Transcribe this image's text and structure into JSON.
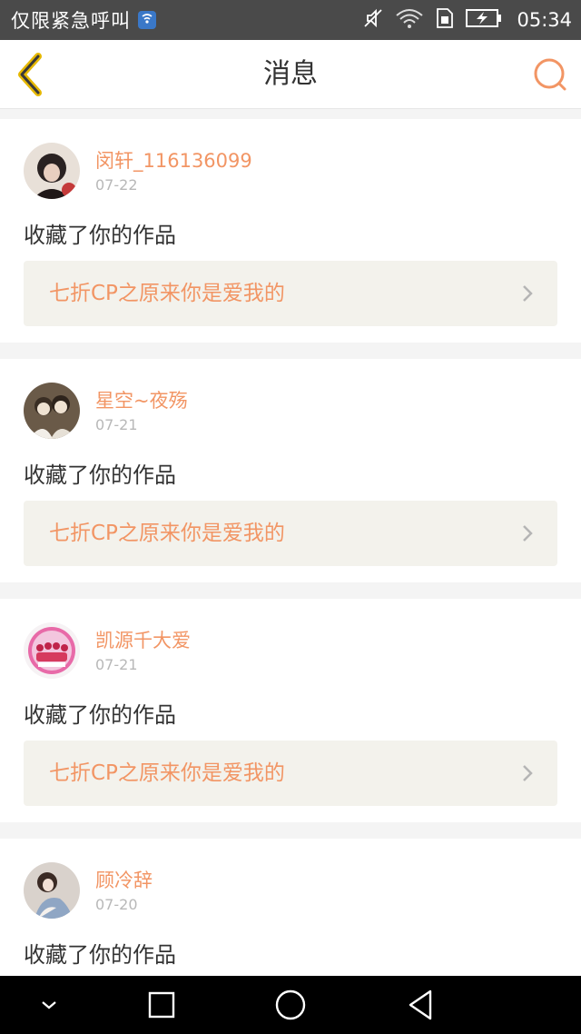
{
  "status_bar": {
    "carrier": "仅限紧急呼叫",
    "time": "05:34"
  },
  "header": {
    "title": "消息"
  },
  "colors": {
    "accent": "#f29564",
    "back_icon": "#e6b800",
    "work_bg": "#f3f2ec"
  },
  "messages": [
    {
      "username": "闵轩_116136099",
      "date": "07-22",
      "action": "收藏了你的作品",
      "work_title": "七折CP之原来你是爱我的",
      "avatar_icon": "avatar-dark-hair-icon"
    },
    {
      "username": "星空~夜殇",
      "date": "07-21",
      "action": "收藏了你的作品",
      "work_title": "七折CP之原来你是爱我的",
      "avatar_icon": "avatar-couple-photo-icon"
    },
    {
      "username": "凯源千大爱",
      "date": "07-21",
      "action": "收藏了你的作品",
      "work_title": "七折CP之原来你是爱我的",
      "avatar_icon": "avatar-group-pink-icon"
    },
    {
      "username": "顾冷辞",
      "date": "07-20",
      "action": "收藏了你的作品",
      "work_title": "",
      "avatar_icon": "avatar-girl-sitting-icon"
    }
  ],
  "nav_bar": {
    "icons": [
      "collapse-icon",
      "recents-icon",
      "home-icon",
      "back-icon"
    ]
  }
}
